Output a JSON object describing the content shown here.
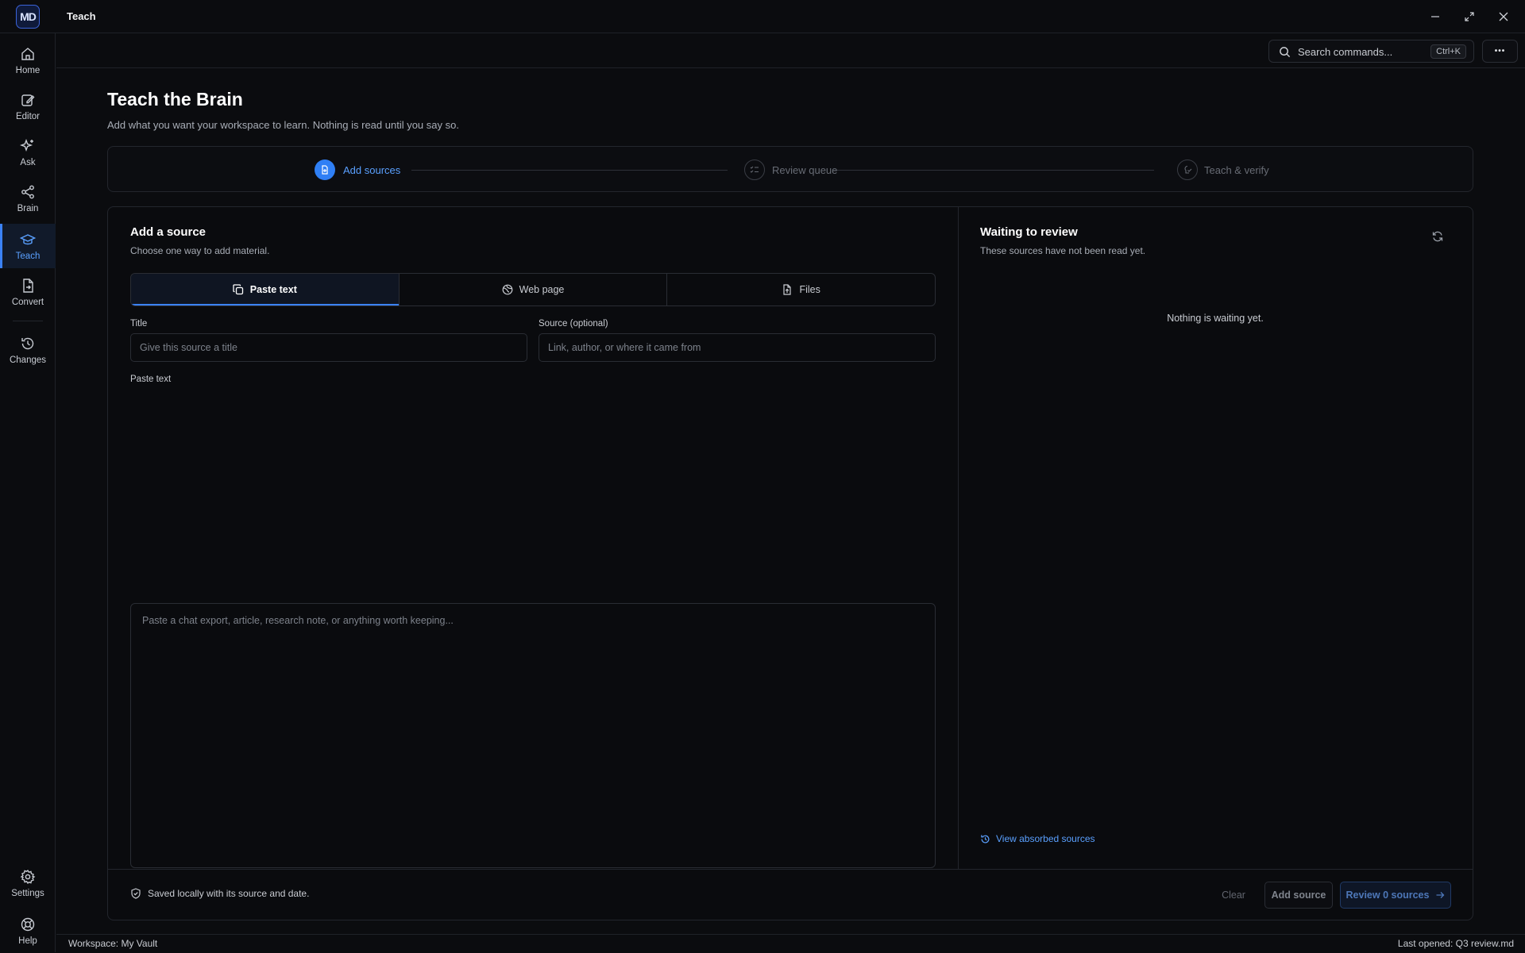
{
  "app": {
    "logo_text": "MD",
    "window_title": "Teach"
  },
  "sidebar": {
    "items": [
      {
        "label": "Home",
        "icon": "home-icon"
      },
      {
        "label": "Editor",
        "icon": "edit-icon"
      },
      {
        "label": "Ask",
        "icon": "sparkle-icon"
      },
      {
        "label": "Brain",
        "icon": "graph-icon"
      },
      {
        "label": "Teach",
        "icon": "graduation-cap-icon",
        "active": true
      },
      {
        "label": "Convert",
        "icon": "file-convert-icon"
      },
      {
        "label": "Changes",
        "icon": "history-icon"
      }
    ],
    "bottom": [
      {
        "label": "Settings",
        "icon": "gear-icon"
      },
      {
        "label": "Help",
        "icon": "lifebuoy-icon"
      }
    ]
  },
  "search": {
    "label": "Search commands...",
    "shortcut": "Ctrl+K"
  },
  "more": {
    "label": "•••"
  },
  "page": {
    "title": "Teach the Brain",
    "subtitle": "Add what you want your workspace to learn. Nothing is read until you say so."
  },
  "stepper": {
    "steps": [
      {
        "label": "Add sources",
        "state": "active"
      },
      {
        "label": "Review queue",
        "state": "idle"
      },
      {
        "label": "Teach & verify",
        "state": "idle"
      }
    ]
  },
  "add_source": {
    "title": "Add a source",
    "subtitle": "Choose one way to add material.",
    "tabs": [
      {
        "label": "Paste text",
        "icon": "copy-icon",
        "active": true
      },
      {
        "label": "Web page",
        "icon": "globe-icon"
      },
      {
        "label": "Files",
        "icon": "file-upload-icon"
      }
    ],
    "title_field": {
      "label": "Title",
      "placeholder": "Give this source a title"
    },
    "source_field": {
      "label": "Source (optional)",
      "placeholder": "Link, author, or where it came from"
    },
    "paste_field": {
      "label": "Paste text",
      "placeholder": "Paste a chat export, article, research note, or anything worth keeping..."
    }
  },
  "waiting": {
    "title": "Waiting to review",
    "subtitle": "These sources have not been read yet.",
    "empty": "Nothing is waiting yet.",
    "absorbed_link": "View absorbed sources"
  },
  "footer": {
    "note": "Saved locally with its source and date.",
    "clear": "Clear",
    "add": "Add source",
    "review": "Review 0 sources"
  },
  "status": {
    "workspace": "Workspace: My Vault",
    "last_opened": "Last opened: Q3 review.md"
  },
  "colors": {
    "accent": "#3b82f6",
    "background": "#0b0c0f",
    "border": "#23262d"
  }
}
